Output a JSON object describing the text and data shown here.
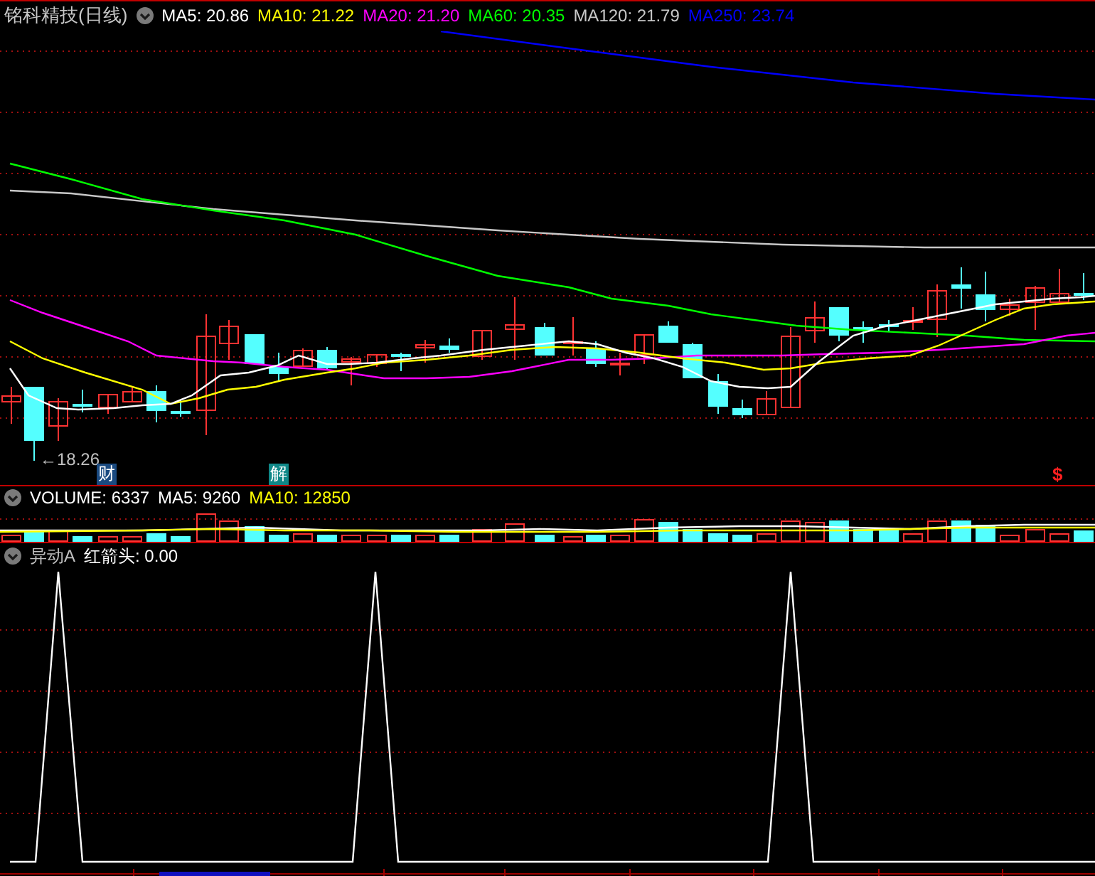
{
  "price_panel": {
    "title": "铭科精技(日线)",
    "indicators": [
      {
        "label": "MA5: 20.86",
        "color": "#ffffff"
      },
      {
        "label": "MA10: 21.22",
        "color": "#ffff00"
      },
      {
        "label": "MA20: 21.20",
        "color": "#ff00ff"
      },
      {
        "label": "MA60: 20.35",
        "color": "#00ff00"
      },
      {
        "label": "MA120: 21.79",
        "color": "#c8c8c8"
      },
      {
        "label": "MA250: 23.74",
        "color": "#0000ff"
      }
    ],
    "low_label": "←18.26",
    "event_badges": [
      {
        "text": "财",
        "kind": "box",
        "color": "#1a4a80"
      },
      {
        "text": "解",
        "kind": "box",
        "color": "#108888"
      },
      {
        "text": "$",
        "kind": "glyph",
        "color": "#ff2020"
      }
    ]
  },
  "volume_panel": {
    "indicators": [
      {
        "label": "VOLUME: 6337",
        "color": "#ffffff"
      },
      {
        "label": "MA5: 9260",
        "color": "#ffffff"
      },
      {
        "label": "MA10: 12850",
        "color": "#ffff00"
      }
    ]
  },
  "signal_panel": {
    "indicators": [
      {
        "label": "异动A",
        "color": "#c0c0c0"
      },
      {
        "label": "红箭头: 0.00",
        "color": "#ffffff"
      }
    ]
  }
}
